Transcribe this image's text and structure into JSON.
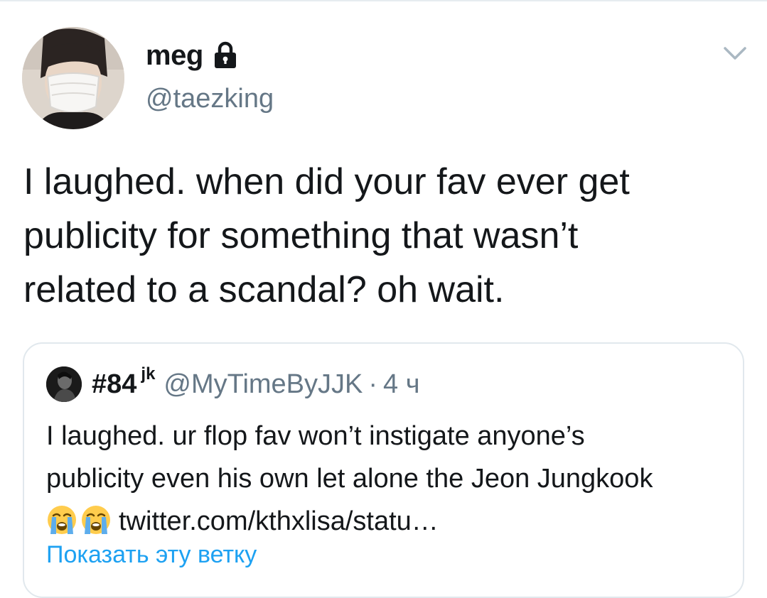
{
  "author": {
    "display_name": "meg",
    "handle": "@taezking",
    "protected_icon": "lock-icon",
    "avatar": "avatar-person-with-white-face-mask"
  },
  "tweet": {
    "text": "I laughed. when did your fav ever get\npublicity for something that wasn’t\nrelated to a scandal? oh wait."
  },
  "menu": {
    "icon": "chevron-down-icon"
  },
  "quoted_tweet": {
    "display_name": "#84",
    "display_name_suffix": "jk",
    "handle": "@MyTimeByJJK",
    "separator": "·",
    "time": "4 ч",
    "text_line1": "I laughed. ur flop fav won’t instigate anyone’s",
    "text_line2": "publicity even  his own let alone the Jeon Jungkook",
    "emoji": [
      "😭",
      "😭"
    ],
    "link_text": "twitter.com/kthxlisa/statu…",
    "show_thread_label": "Показать эту ветку"
  },
  "colors": {
    "text_primary": "#14171a",
    "text_secondary": "#657786",
    "link_blue": "#1da1f2",
    "border": "#e1e8ed"
  }
}
